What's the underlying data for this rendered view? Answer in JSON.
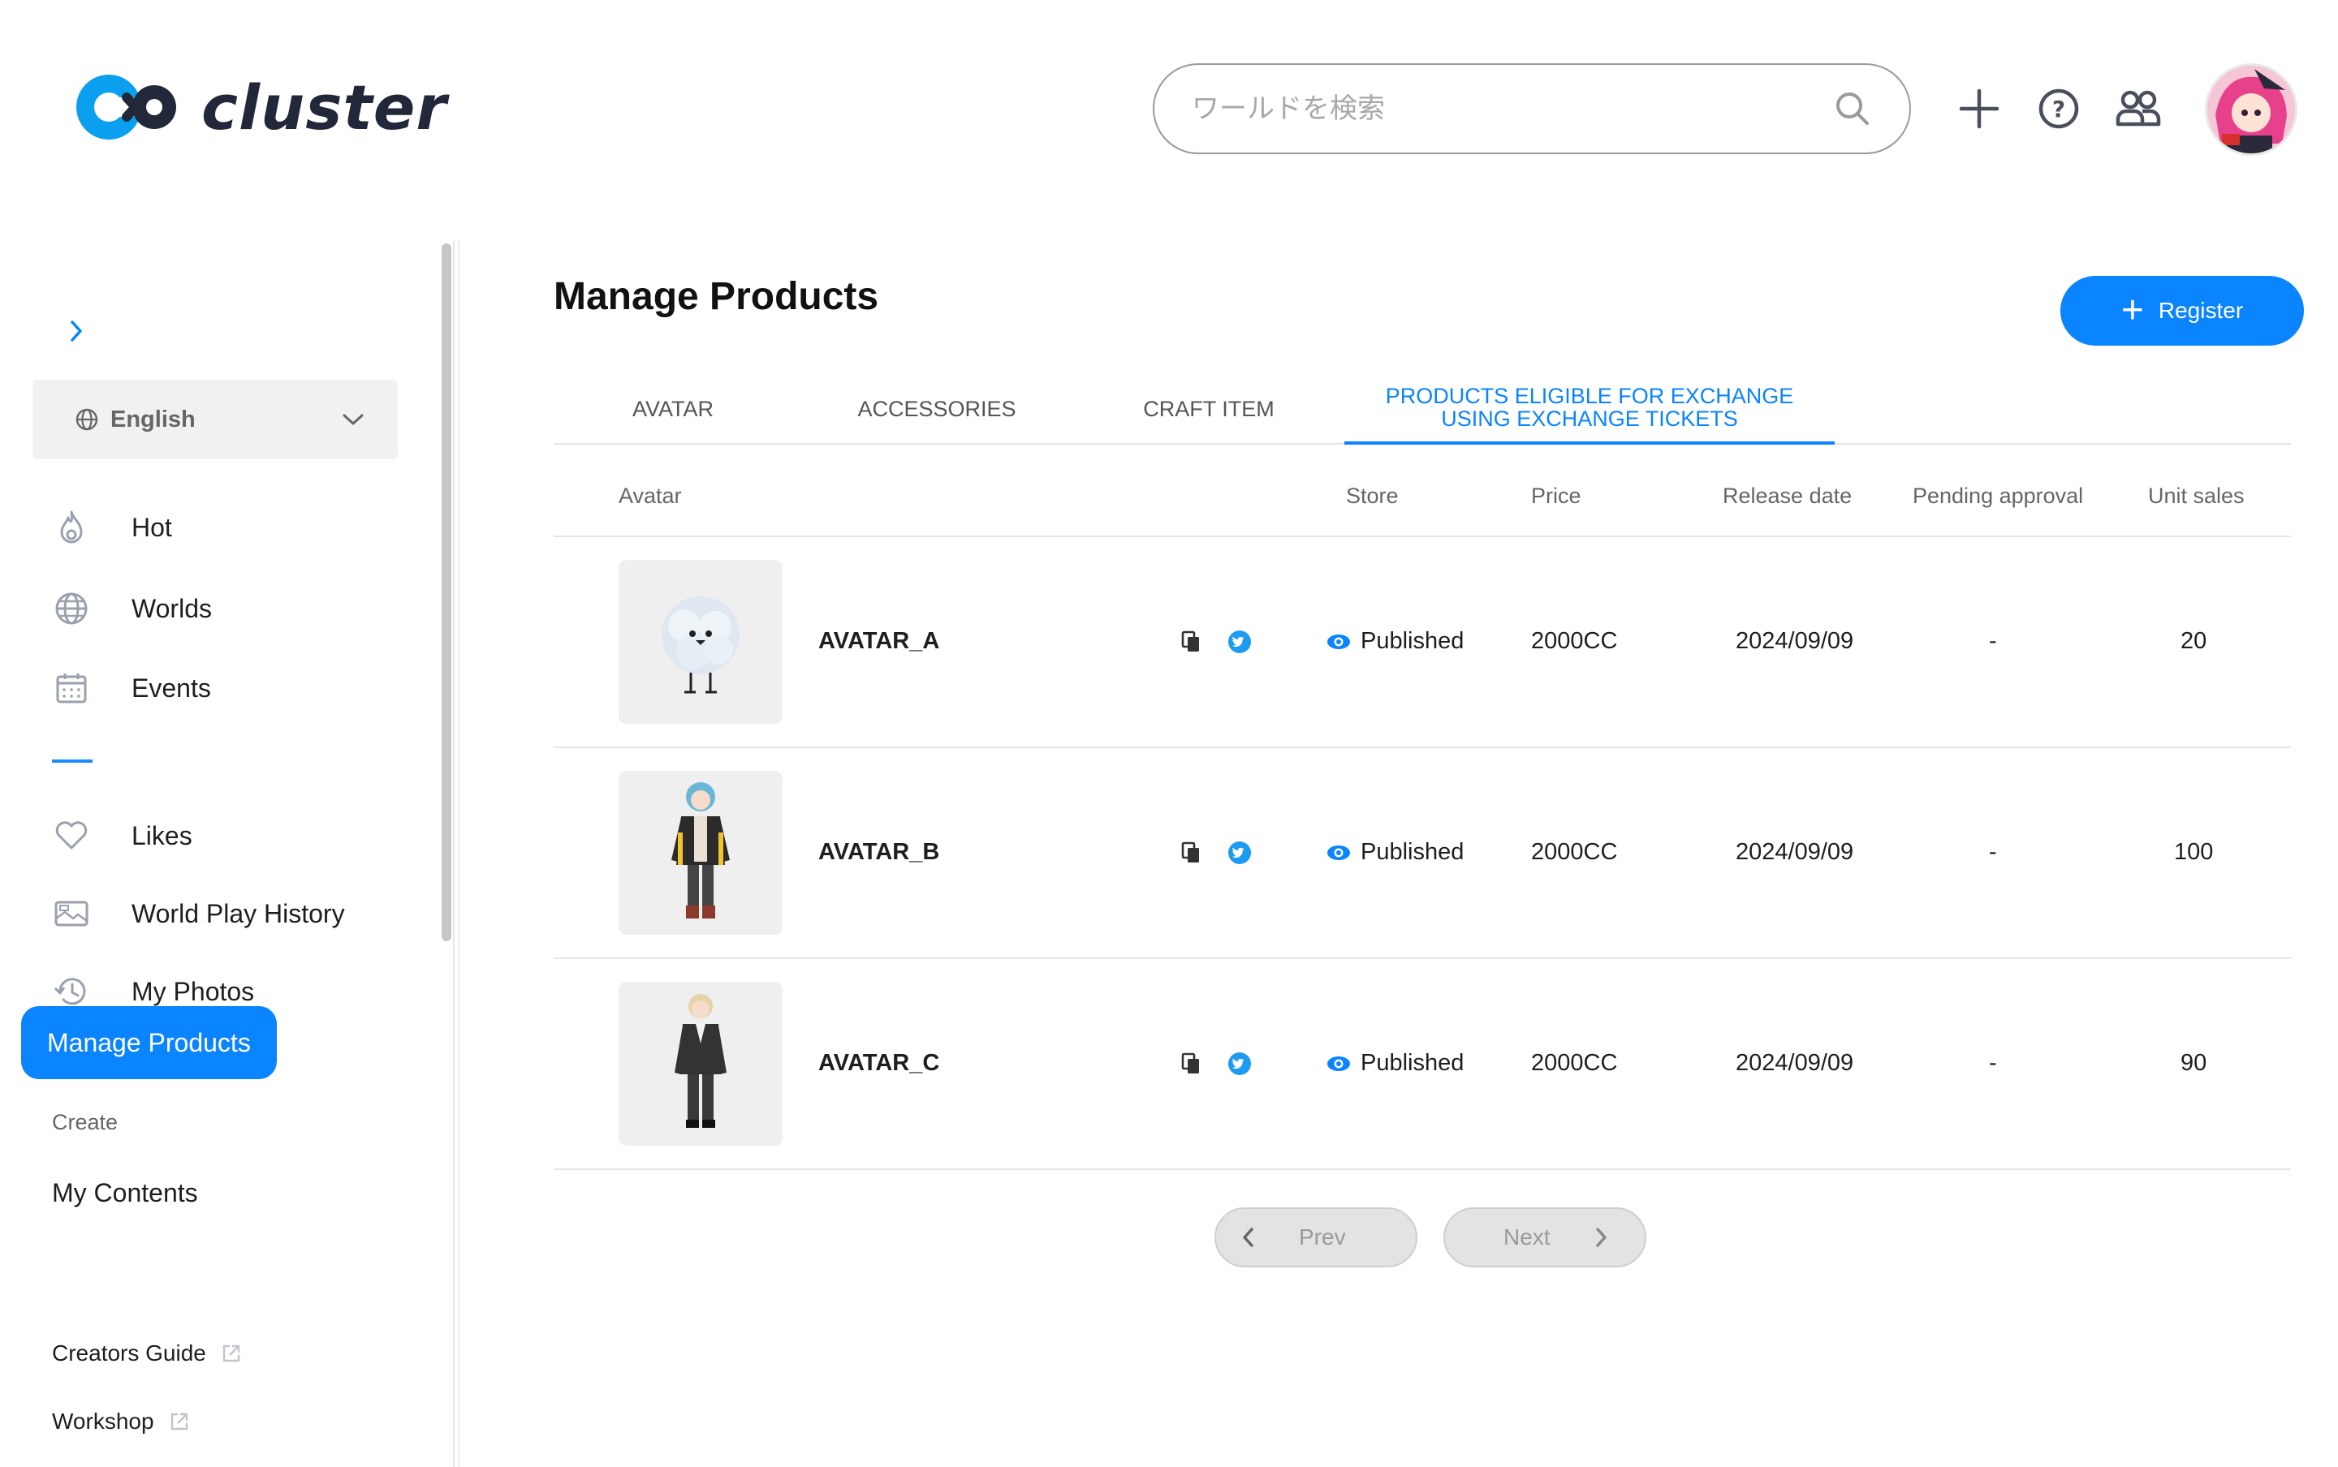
{
  "brand": {
    "name": "cluster",
    "accent": "#0a84ff"
  },
  "header": {
    "search_placeholder": "ワールドを検索",
    "icons": [
      "search-icon",
      "plus-icon",
      "help-icon",
      "friends-icon",
      "user-avatar"
    ]
  },
  "sidebar": {
    "language": "English",
    "nav": [
      {
        "label": "Hot",
        "icon": "fire-icon"
      },
      {
        "label": "Worlds",
        "icon": "globe-icon"
      },
      {
        "label": "Events",
        "icon": "calendar-icon"
      },
      {
        "label": "Likes",
        "icon": "heart-icon"
      },
      {
        "label": "World Play History",
        "icon": "history-map-icon"
      },
      {
        "label": "My Photos",
        "icon": "clock-history-icon"
      }
    ],
    "create_label": "Create",
    "my_contents": "My Contents",
    "manage_products": "Manage Products",
    "creators_guide": "Creators Guide",
    "workshop": "Workshop"
  },
  "main": {
    "title": "Manage Products",
    "register_label": "Register",
    "tabs": [
      {
        "label": "AVATAR",
        "active": false
      },
      {
        "label": "ACCESSORIES",
        "active": false
      },
      {
        "label": "CRAFT ITEM",
        "active": false
      },
      {
        "label": "PRODUCTS ELIGIBLE FOR EXCHANGE USING EXCHANGE TICKETS",
        "active": true
      }
    ],
    "columns": {
      "avatar": "Avatar",
      "store": "Store",
      "price": "Price",
      "release": "Release date",
      "pending": "Pending approval",
      "sales": "Unit sales"
    },
    "rows": [
      {
        "name": "AVATAR_A",
        "store": "Published",
        "price": "2000CC",
        "release": "2024/09/09",
        "pending": "-",
        "sales": "20"
      },
      {
        "name": "AVATAR_B",
        "store": "Published",
        "price": "2000CC",
        "release": "2024/09/09",
        "pending": "-",
        "sales": "100"
      },
      {
        "name": "AVATAR_C",
        "store": "Published",
        "price": "2000CC",
        "release": "2024/09/09",
        "pending": "-",
        "sales": "90"
      }
    ],
    "pager": {
      "prev": "Prev",
      "next": "Next"
    }
  }
}
